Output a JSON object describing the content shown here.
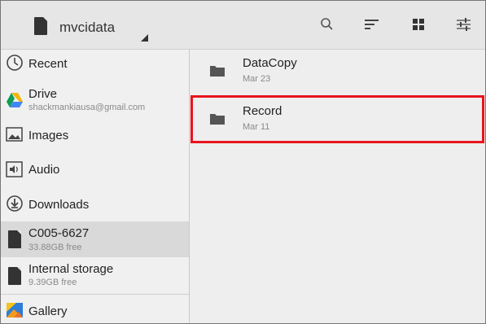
{
  "toolbar": {
    "root_title": "mvcidata",
    "icons": [
      "search-icon",
      "sort-icon",
      "grid-view-icon",
      "settings-sliders-icon"
    ]
  },
  "sidebar": {
    "items": [
      {
        "label": "Recent",
        "icon": "clock-icon"
      },
      {
        "label": "Drive",
        "sublabel": "shackmankiausa@gmail.com",
        "icon": "google-drive-icon"
      },
      {
        "label": "Images",
        "icon": "image-icon"
      },
      {
        "label": "Audio",
        "icon": "audio-icon"
      },
      {
        "label": "Downloads",
        "icon": "download-icon"
      },
      {
        "label": "C005-6627",
        "sublabel": "33.88GB free",
        "icon": "sd-card-icon",
        "selected": true
      },
      {
        "label": "Internal storage",
        "sublabel": "9.39GB free",
        "icon": "sd-card-icon"
      },
      {
        "label": "Gallery",
        "icon": "gallery-icon"
      }
    ]
  },
  "files": [
    {
      "name": "DataCopy",
      "date": "Mar 23",
      "icon": "folder-icon"
    },
    {
      "name": "Record",
      "date": "Mar 11",
      "icon": "folder-icon",
      "highlighted": true
    }
  ],
  "colors": {
    "toolbar_bg": "#e6e6e6",
    "sidebar_bg": "#f0f0f0",
    "selected_bg": "#d9d9d9",
    "main_bg": "#eeeeee",
    "highlight_border": "#e8141c"
  }
}
